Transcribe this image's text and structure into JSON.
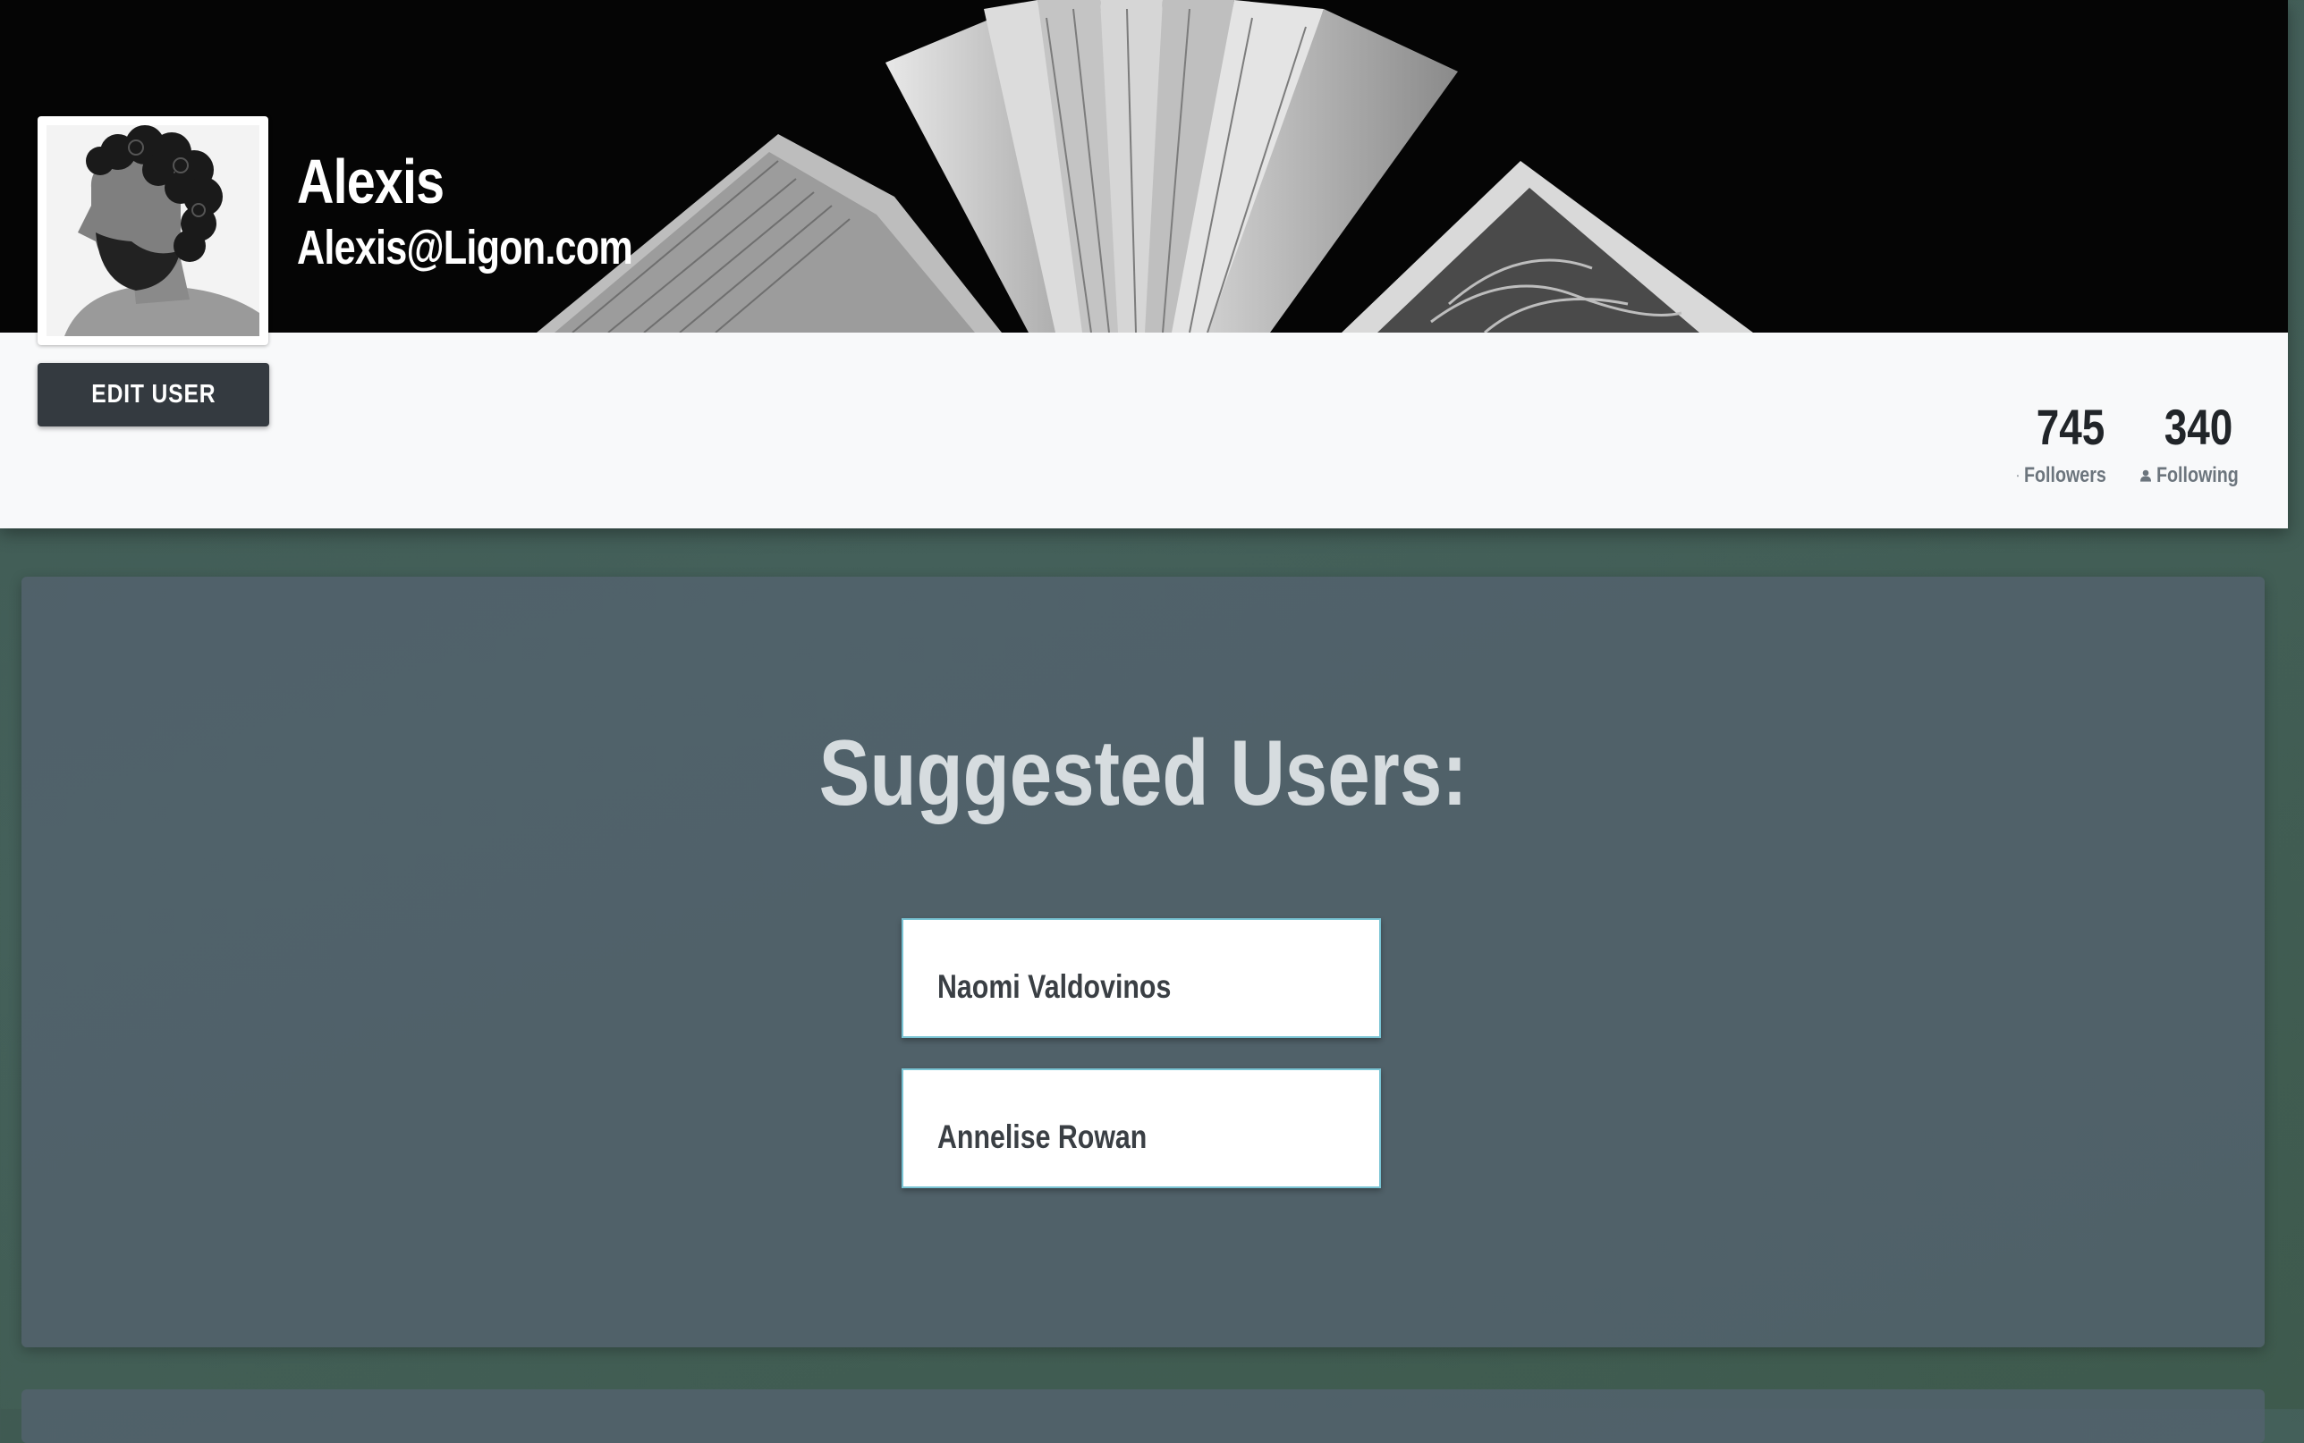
{
  "profile": {
    "name": "Alexis",
    "email": "Alexis@Ligon.com",
    "edit_button_label": "EDIT USER",
    "cover_image": "open-book-photo",
    "avatar_image": "curly-haired-man-profile-photo"
  },
  "stats": {
    "followers": {
      "count": "745",
      "label": "Followers",
      "icon": "person-icon"
    },
    "following": {
      "count": "340",
      "label": "Following",
      "icon": "person-icon"
    }
  },
  "suggested": {
    "title": "Suggested Users:",
    "users": [
      {
        "name": "Naomi Valdovinos"
      },
      {
        "name": "Annelise Rowan"
      }
    ]
  },
  "colors": {
    "page_background": "#40594f",
    "panel_background": "#52626c",
    "button_background": "#343a40",
    "card_border": "#79c4d4",
    "header_strip": "#f8f9fa"
  }
}
